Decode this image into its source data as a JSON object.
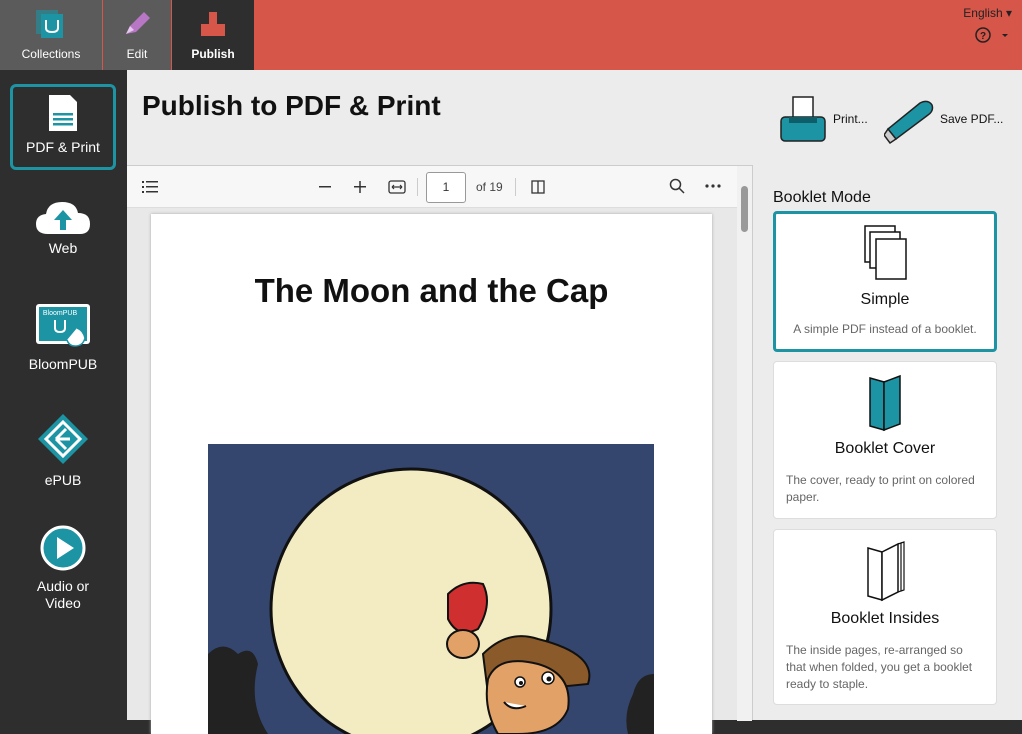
{
  "topbar": {
    "tabs": [
      {
        "label": "Collections",
        "icon": "collections-icon"
      },
      {
        "label": "Edit",
        "icon": "pencil-icon"
      },
      {
        "label": "Publish",
        "icon": "publish-icon"
      }
    ],
    "language": "English"
  },
  "sidebar": {
    "items": [
      {
        "label": "PDF & Print",
        "icon": "pdf-document-icon"
      },
      {
        "label": "Web",
        "icon": "cloud-upload-icon"
      },
      {
        "label": "BloomPUB",
        "icon": "bloompub-device-icon",
        "badge": "BloomPUB"
      },
      {
        "label": "ePUB",
        "icon": "epub-icon"
      },
      {
        "label": "Audio or Video",
        "line1": "Audio or",
        "line2": "Video",
        "icon": "play-icon"
      }
    ]
  },
  "main": {
    "title": "Publish to PDF & Print",
    "print_label": "Print...",
    "save_pdf_label": "Save PDF..."
  },
  "viewer": {
    "page_number": "1",
    "page_count": "of 19",
    "book_title": "The Moon and the Cap"
  },
  "booklet": {
    "heading": "Booklet Mode",
    "options": [
      {
        "title": "Simple",
        "desc": "A simple PDF instead of a booklet.",
        "selected": true
      },
      {
        "title": "Booklet Cover",
        "desc": "The cover, ready to print on colored paper.",
        "selected": false
      },
      {
        "title": "Booklet Insides",
        "desc": "The inside pages, re-arranged so that when folded, you get a booklet ready to staple.",
        "selected": false
      }
    ]
  },
  "colors": {
    "topbar": "#d65649",
    "accent": "#1d94a4",
    "sidebar": "#2e2e2e"
  }
}
